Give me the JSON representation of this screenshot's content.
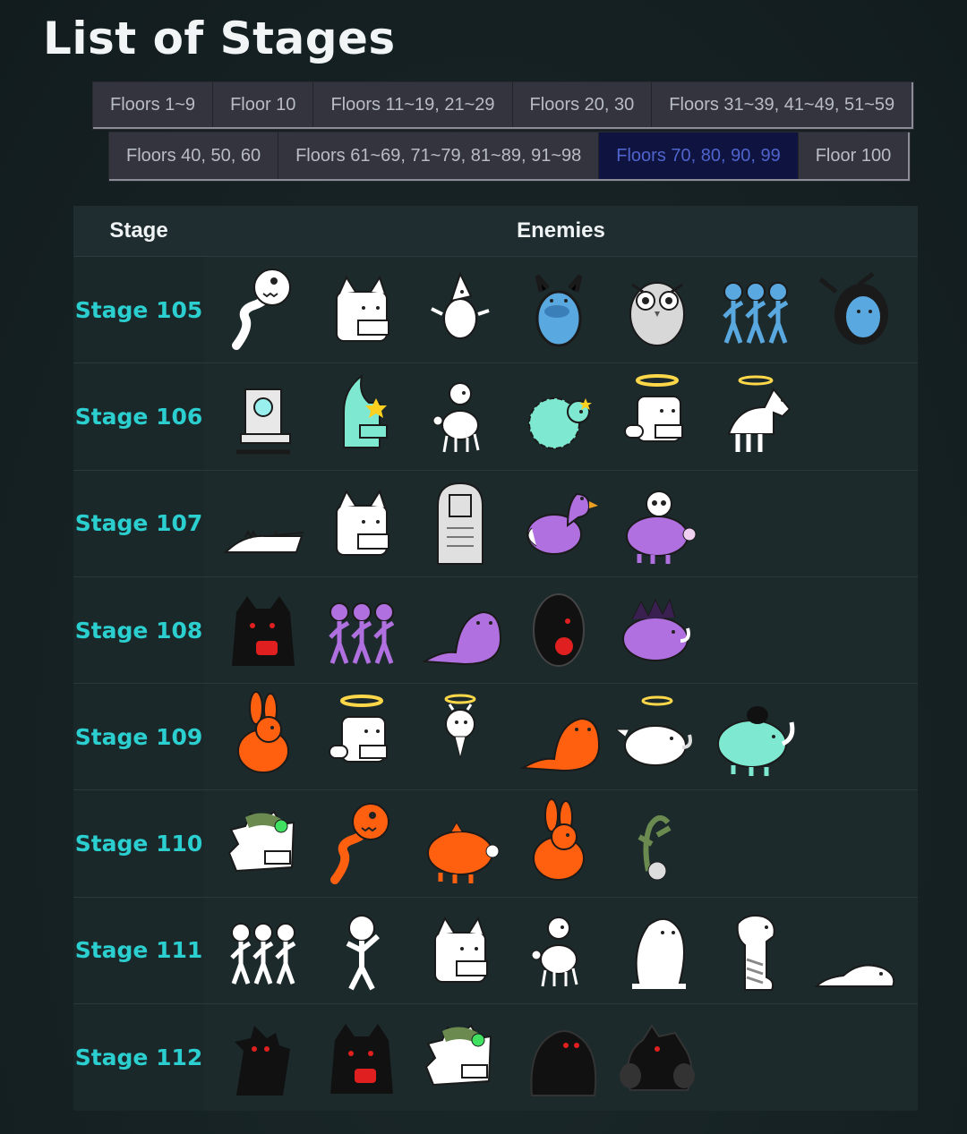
{
  "page": {
    "title": "List of Stages"
  },
  "tabs_row1": [
    {
      "label": "Floors 1~9",
      "active": false
    },
    {
      "label": "Floor 10",
      "active": false
    },
    {
      "label": "Floors 11~19, 21~29",
      "active": false
    },
    {
      "label": "Floors 20, 30",
      "active": false
    },
    {
      "label": "Floors 31~39, 41~49, 51~59",
      "active": false
    }
  ],
  "tabs_row2": [
    {
      "label": "Floors 40, 50, 60",
      "active": false
    },
    {
      "label": "Floors 61~69, 71~79, 81~89, 91~98",
      "active": false
    },
    {
      "label": "Floors 70, 80, 90, 99",
      "active": true
    },
    {
      "label": "Floor 100",
      "active": false
    }
  ],
  "table": {
    "col_stage": "Stage",
    "col_enemies": "Enemies",
    "rows": [
      {
        "stage": "Stage 105",
        "enemies": [
          {
            "icon": "snake",
            "color": "#ffffff"
          },
          {
            "icon": "cat-box",
            "color": "#ffffff"
          },
          {
            "icon": "bird",
            "color": "#ffffff"
          },
          {
            "icon": "penguin",
            "color": "#5aa8e0"
          },
          {
            "icon": "owl",
            "color": "#d8d8d8"
          },
          {
            "icon": "stickmen",
            "color": "#5aa8e0"
          },
          {
            "icon": "ghost-head",
            "color": "#5aa8e0"
          }
        ]
      },
      {
        "stage": "Stage 106",
        "enemies": [
          {
            "icon": "throne",
            "color": "#e8e8e8"
          },
          {
            "icon": "shark-cat",
            "color": "#7fe8d0"
          },
          {
            "icon": "poodle",
            "color": "#ffffff"
          },
          {
            "icon": "sheep",
            "color": "#7fe8d0"
          },
          {
            "icon": "angel-box",
            "color": "#ffffff"
          },
          {
            "icon": "horse",
            "color": "#ffffff"
          }
        ]
      },
      {
        "stage": "Stage 107",
        "enemies": [
          {
            "icon": "crocodile",
            "color": "#ffffff"
          },
          {
            "icon": "cat-box",
            "color": "#ffffff"
          },
          {
            "icon": "gravestone",
            "color": "#e0e0e0"
          },
          {
            "icon": "duck",
            "color": "#b070e0"
          },
          {
            "icon": "pig-skull",
            "color": "#b070e0"
          }
        ]
      },
      {
        "stage": "Stage 108",
        "enemies": [
          {
            "icon": "shadow-beast",
            "color": "#111111"
          },
          {
            "icon": "stickmen",
            "color": "#b070e0"
          },
          {
            "icon": "seal",
            "color": "#b070e0"
          },
          {
            "icon": "shadow-egg",
            "color": "#111111"
          },
          {
            "icon": "boar",
            "color": "#b070e0"
          }
        ]
      },
      {
        "stage": "Stage 109",
        "enemies": [
          {
            "icon": "rabbit",
            "color": "#ff6010"
          },
          {
            "icon": "angel-box",
            "color": "#ffffff"
          },
          {
            "icon": "angel-small",
            "color": "#ffffff"
          },
          {
            "icon": "seal",
            "color": "#ff6010"
          },
          {
            "icon": "angel-boar",
            "color": "#ffffff"
          },
          {
            "icon": "rhino",
            "color": "#7fe8d0"
          }
        ]
      },
      {
        "stage": "Stage 110",
        "enemies": [
          {
            "icon": "hedgehog",
            "color": "#ffffff"
          },
          {
            "icon": "snake",
            "color": "#ff6010"
          },
          {
            "icon": "pig",
            "color": "#ff6010"
          },
          {
            "icon": "rabbit",
            "color": "#ff6010"
          },
          {
            "icon": "plant",
            "color": "#6a8a50"
          }
        ]
      },
      {
        "stage": "Stage 111",
        "enemies": [
          {
            "icon": "stickmen",
            "color": "#ffffff"
          },
          {
            "icon": "stickman",
            "color": "#ffffff"
          },
          {
            "icon": "cat-box",
            "color": "#ffffff"
          },
          {
            "icon": "poodle",
            "color": "#ffffff"
          },
          {
            "icon": "seal-up",
            "color": "#ffffff"
          },
          {
            "icon": "merlion",
            "color": "#ffffff"
          },
          {
            "icon": "slug",
            "color": "#ffffff"
          }
        ]
      },
      {
        "stage": "Stage 112",
        "enemies": [
          {
            "icon": "shadow-throne",
            "color": "#111111"
          },
          {
            "icon": "shadow-beast",
            "color": "#111111"
          },
          {
            "icon": "hedgehog",
            "color": "#ffffff"
          },
          {
            "icon": "gorilla",
            "color": "#111111"
          },
          {
            "icon": "shadow-bear",
            "color": "#111111"
          }
        ]
      }
    ]
  }
}
